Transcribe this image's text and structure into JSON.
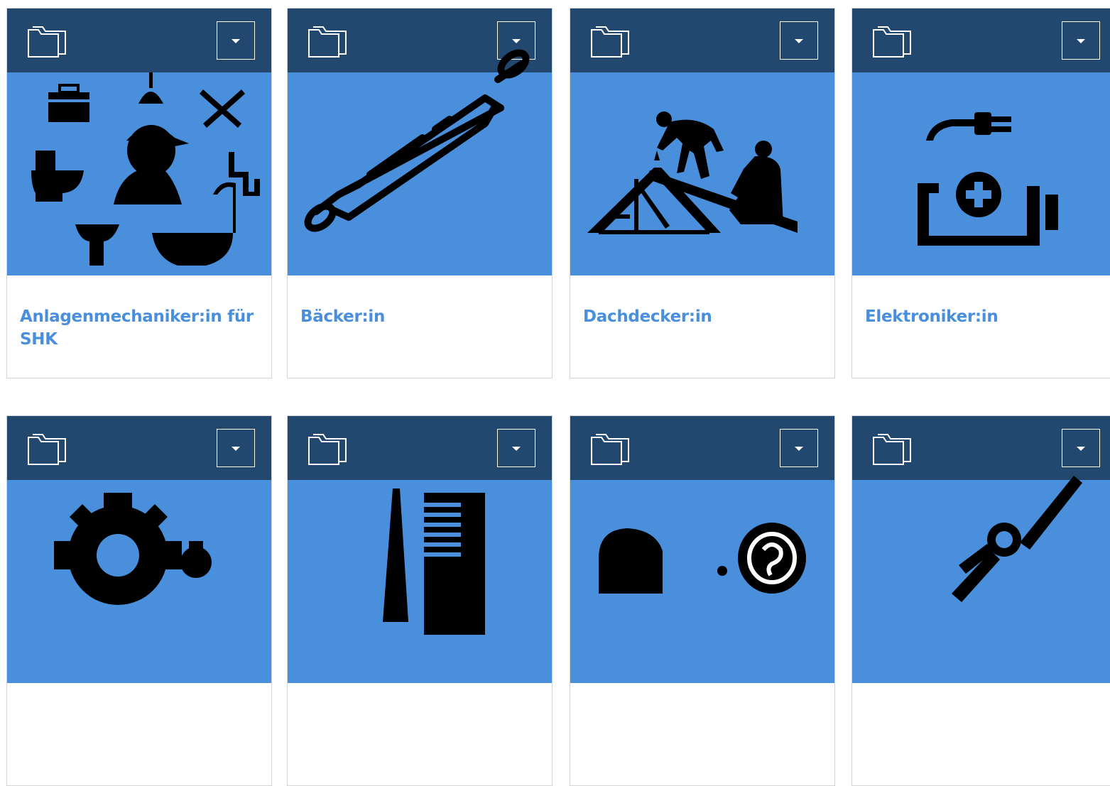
{
  "cards": [
    {
      "title": "Anlagenmechaniker:in für SHK",
      "image_icon": "plumber-tools-icon"
    },
    {
      "title": "Bäcker:in",
      "image_icon": "rolling-pin-icon"
    },
    {
      "title": "Dachdecker:in",
      "image_icon": "roofers-icon"
    },
    {
      "title": "Elektroniker:in",
      "image_icon": "plug-battery-icon"
    },
    {
      "title": "",
      "image_icon": "gears-icon"
    },
    {
      "title": "",
      "image_icon": "comb-scissors-icon"
    },
    {
      "title": "",
      "image_icon": "hearing-aid-icon"
    },
    {
      "title": "",
      "image_icon": "pliers-icon"
    }
  ],
  "icons": {
    "header_left": "folder-icon",
    "header_right": "dropdown-caret-icon"
  },
  "colors": {
    "header": "#234870",
    "image_bg": "#4a8fdb",
    "title": "#4a8fdb",
    "border": "#d4d4d4"
  }
}
